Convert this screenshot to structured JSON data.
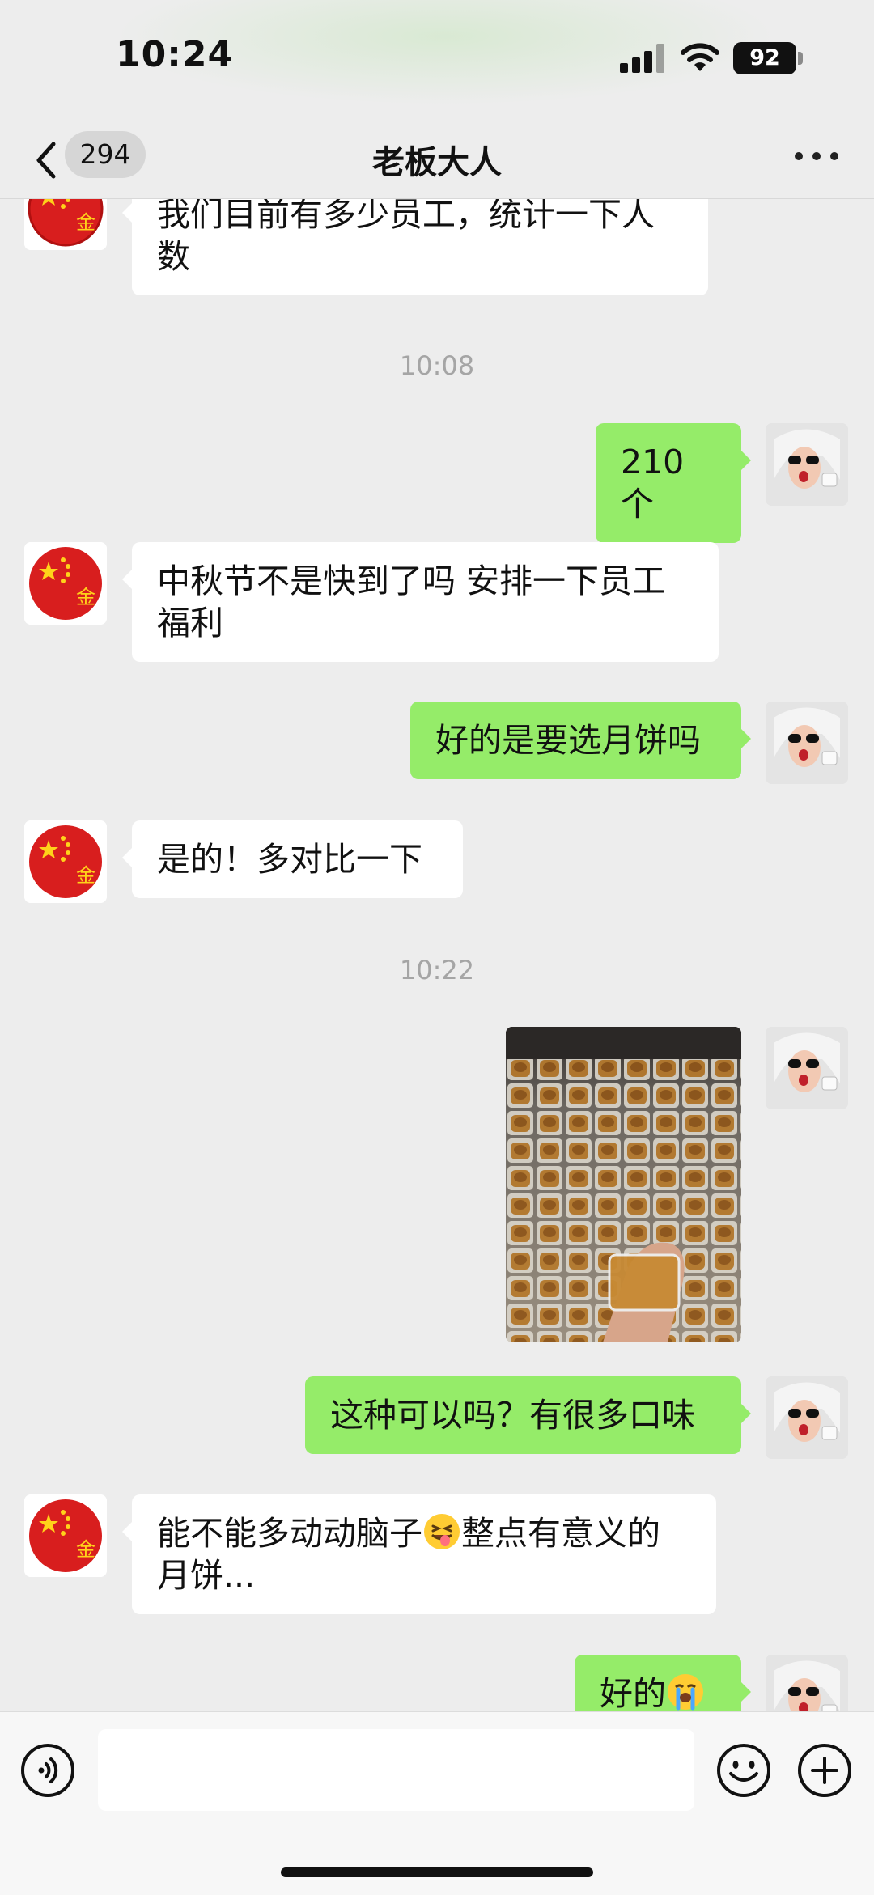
{
  "status_bar": {
    "time": "10:24",
    "battery": "92",
    "icons": [
      "cellular-signal-icon",
      "wifi-icon",
      "battery-icon"
    ]
  },
  "nav": {
    "back_icon": "chevron-left-icon",
    "unread_count": "294",
    "title": "老板大人",
    "more_icon": "more-dots-icon"
  },
  "messages": [
    {
      "sender": "boss",
      "type": "text",
      "text": "我们目前有多少员工，统计一下人数"
    },
    {
      "type": "timestamp",
      "text": "10:08"
    },
    {
      "sender": "me",
      "type": "text",
      "text": "210个"
    },
    {
      "sender": "boss",
      "type": "text",
      "text": "中秋节不是快到了吗 安排一下员工福利"
    },
    {
      "sender": "me",
      "type": "text",
      "text": "好的是要选月饼吗"
    },
    {
      "sender": "boss",
      "type": "text",
      "text": "是的！多对比一下"
    },
    {
      "type": "timestamp",
      "text": "10:22"
    },
    {
      "sender": "me",
      "type": "image",
      "image_desc": "mooncake-trays-photo"
    },
    {
      "sender": "me",
      "type": "text",
      "text": "这种可以吗？有很多口味"
    },
    {
      "sender": "boss",
      "type": "text",
      "text_before": "能不能多动动脑子",
      "emoji": "tongue-out-emoji",
      "text_after": "整点有意义的月饼..."
    },
    {
      "sender": "me",
      "type": "text",
      "text": "好的",
      "emoji": "crying-emoji"
    }
  ],
  "colors": {
    "background": "#ededed",
    "outgoing_bubble": "#95ec69",
    "incoming_bubble": "#ffffff",
    "timestamp": "#a5a5a5"
  },
  "input_bar": {
    "voice_icon": "voice-icon",
    "emoji_icon": "emoji-face-icon",
    "plus_icon": "plus-circle-icon"
  }
}
